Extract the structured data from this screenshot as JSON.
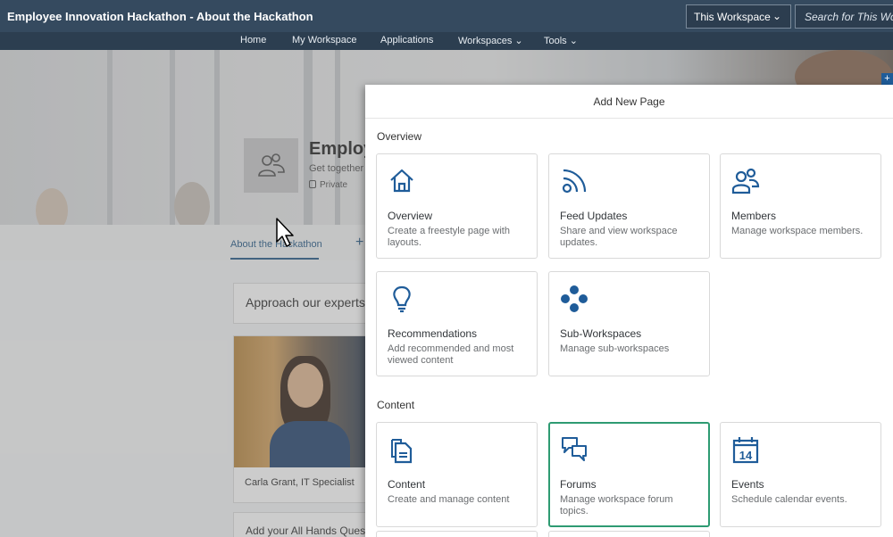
{
  "header": {
    "app_title": "Employee Innovation Hackathon - About the Hackathon",
    "workspace_select": "This Workspace",
    "search_placeholder": "Search for This Workspace"
  },
  "nav": {
    "items": [
      {
        "label": "Home"
      },
      {
        "label": "My Workspace"
      },
      {
        "label": "Applications"
      },
      {
        "label": "Workspaces"
      },
      {
        "label": "Tools"
      }
    ]
  },
  "workspace": {
    "title": "Employ",
    "subtitle": "Get together a",
    "privacy": "Private"
  },
  "tabs": {
    "active": "About the Hackathon",
    "add": "+"
  },
  "background_cards": {
    "experts": "Approach our experts",
    "caption": "Carla Grant, IT Specialist",
    "questions": "Add your All Hands Ques"
  },
  "dialog": {
    "title": "Add New Page",
    "sections": [
      {
        "label": "Overview",
        "tiles": [
          {
            "title": "Overview",
            "desc": "Create a freestyle page with layouts.",
            "icon": "home-icon"
          },
          {
            "title": "Feed Updates",
            "desc": "Share and view workspace updates.",
            "icon": "feed-icon"
          },
          {
            "title": "Members",
            "desc": "Manage workspace members.",
            "icon": "members-icon"
          },
          {
            "title": "Recommendations",
            "desc": "Add recommended and most viewed content",
            "icon": "lightbulb-icon"
          },
          {
            "title": "Sub-Workspaces",
            "desc": "Manage sub-workspaces",
            "icon": "sub-workspaces-icon"
          }
        ]
      },
      {
        "label": "Content",
        "tiles": [
          {
            "title": "Content",
            "desc": "Create and manage content",
            "icon": "document-icon"
          },
          {
            "title": "Forums",
            "desc": "Manage workspace forum topics.",
            "icon": "forum-icon"
          },
          {
            "title": "Events",
            "desc": "Schedule calendar events.",
            "icon": "calendar-icon",
            "calendar_day": "14"
          }
        ]
      }
    ]
  },
  "colors": {
    "topbar": "#354a5f",
    "navbar": "#2c3e50",
    "icon_blue": "#1f5c99",
    "highlight_green": "#2e9b72"
  }
}
